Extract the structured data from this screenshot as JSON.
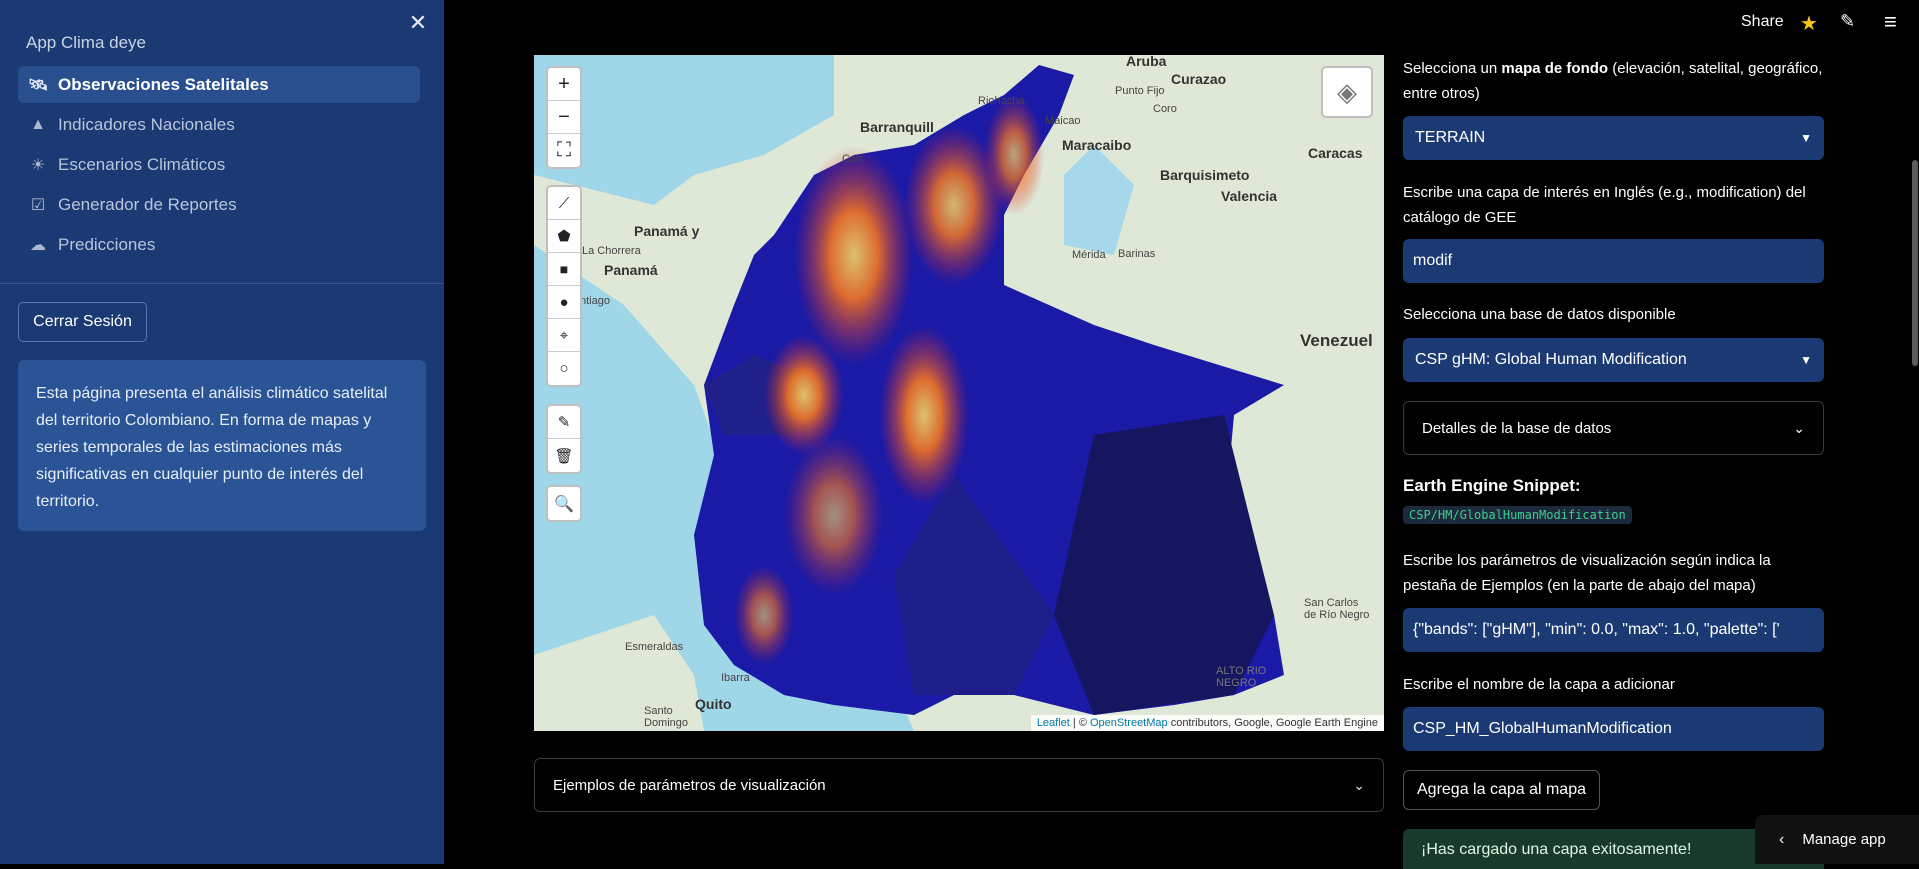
{
  "app": {
    "title": "App Clima deye",
    "close_icon": "close-icon"
  },
  "header": {
    "share": "Share",
    "icons": [
      "star-icon",
      "edit-icon",
      "menu-icon"
    ]
  },
  "sidebar": {
    "items": [
      {
        "label": "Observaciones Satelitales",
        "icon": "satellite-icon",
        "active": true
      },
      {
        "label": "Indicadores Nacionales",
        "icon": "mountain-icon",
        "active": false
      },
      {
        "label": "Escenarios Climáticos",
        "icon": "sun-icon",
        "active": false
      },
      {
        "label": "Generador de Reportes",
        "icon": "checkbox-icon",
        "active": false
      },
      {
        "label": "Predicciones",
        "icon": "cloud-icon",
        "active": false
      }
    ],
    "logout_label": "Cerrar Sesión",
    "info_text": "Esta página presenta el análisis climático satelital del territorio Colombiano. En forma de mapas y series temporales de las estimaciones más significativas en cualquier punto de interés del territorio."
  },
  "map": {
    "labels": {
      "aruba": "Aruba",
      "curazao": "Curazao",
      "punto_fijo": "Punto Fijo",
      "riohacha": "Riohacha",
      "coro": "Coro",
      "barranquilla": "Barranquill",
      "maicao": "Maicao",
      "maracaibo": "Maracaibo",
      "caracas": "Caracas",
      "cartagena": "Cart",
      "barquisimeto": "Barquisimeto",
      "valencia": "Valencia",
      "panama_y": "Panamá y",
      "la_chorrera": "La Chorrera",
      "panama": "Panamá",
      "merida": "Mérida",
      "barinas": "Barinas",
      "santiago": "ntiago",
      "venezuela": "Venezuel",
      "esmeraldas": "Esmeraldas",
      "san_carlos": "San Carlos\nde Río Negro",
      "ibarra": "Ibarra",
      "alto_rio_negro": "ALTO RIO\nNEGRO",
      "quito": "Quito",
      "santo_domingo": "Santo\nDomingo"
    },
    "attribution": {
      "leaflet": "Leaflet",
      "sep": " | © ",
      "osm": "OpenStreetMap",
      "rest": " contributors, Google, Google Earth Engine"
    },
    "controls": {
      "zoom": [
        "zoom-in-icon",
        "zoom-out-icon",
        "fullscreen-icon"
      ],
      "draw": [
        "polyline-icon",
        "polygon-icon",
        "rectangle-icon",
        "circle-icon",
        "marker-icon",
        "circle-marker-icon"
      ],
      "edit": [
        "edit-layers-icon",
        "delete-layers-icon"
      ],
      "search": "search-icon",
      "layers": "layers-icon"
    }
  },
  "examples_expander": "Ejemplos de parámetros de visualización",
  "panel": {
    "basemap_label_pre": "Selecciona un ",
    "basemap_label_bold": "mapa de fondo",
    "basemap_label_post": " (elevación, satelital, geográfico, entre otros)",
    "basemap_value": "TERRAIN",
    "layer_search_label": "Escribe una capa de interés en Inglés (e.g., modification) del catálogo de GEE",
    "layer_search_value": "modif",
    "dataset_label": "Selecciona una base de datos disponible",
    "dataset_value": "CSP gHM: Global Human Modification",
    "details_expander": "Detalles de la base de datos",
    "snippet_heading": "Earth Engine Snippet:",
    "snippet_code": "CSP/HM/GlobalHumanModification",
    "vis_params_label": "Escribe los parámetros de visualización según indica la pestaña de Ejemplos (en la parte de abajo del mapa)",
    "vis_params_value": "{\"bands\": [\"gHM\"], \"min\": 0.0, \"max\": 1.0,  \"palette\": ['",
    "layer_name_label": "Escribe el nombre de la capa a adicionar",
    "layer_name_value": "CSP_HM_GlobalHumanModification",
    "add_button": "Agrega la capa al mapa",
    "success_msg": "¡Has cargado una capa exitosamente!"
  },
  "manage_app": "Manage app"
}
